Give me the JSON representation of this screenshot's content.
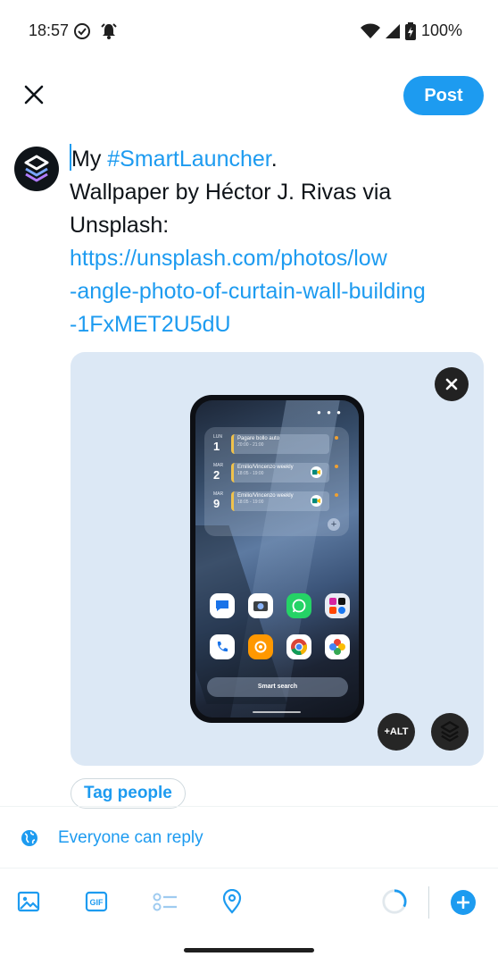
{
  "status_bar": {
    "time": "18:57",
    "battery": "100%"
  },
  "toolbar_top": {
    "post_label": "Post"
  },
  "compose": {
    "word_my": "My",
    "hashtag": "#SmartLauncher",
    "period": ".",
    "line2": "Wallpaper by Héctor J. Rivas via",
    "line3": "Unsplash:",
    "url_line1": "https://unsplash.com/photos/low",
    "url_line2": "-angle-photo-of-curtain-wall-building",
    "url_line3": "-1FxMET2U5dU"
  },
  "media": {
    "alt_label": "+ALT",
    "phone": {
      "calendar": [
        {
          "day_name": "LUN",
          "day_num": "1",
          "title": "Pagare bollo auto",
          "time": "20:00 - 21:00",
          "meet": false
        },
        {
          "day_name": "MAR",
          "day_num": "2",
          "title": "Emilio/Vincenzo weekly",
          "time": "18:05 - 19:00",
          "meet": true
        },
        {
          "day_name": "MAR",
          "day_num": "9",
          "title": "Emilio/Vincenzo weekly",
          "time": "18:05 - 19:00",
          "meet": true
        }
      ],
      "search_label": "Smart search"
    }
  },
  "tag_people": "Tag people",
  "reply_setting": "Everyone can reply",
  "icons": {
    "close": "close-icon",
    "media_remove": "close-icon",
    "globe": "globe-icon",
    "image": "image-icon",
    "gif": "gif-icon",
    "poll": "poll-icon",
    "location": "location-pin-icon",
    "progress": "character-count-ring",
    "add": "plus-icon"
  },
  "colors": {
    "accent": "#1d9bf0",
    "text": "#0f1419"
  }
}
